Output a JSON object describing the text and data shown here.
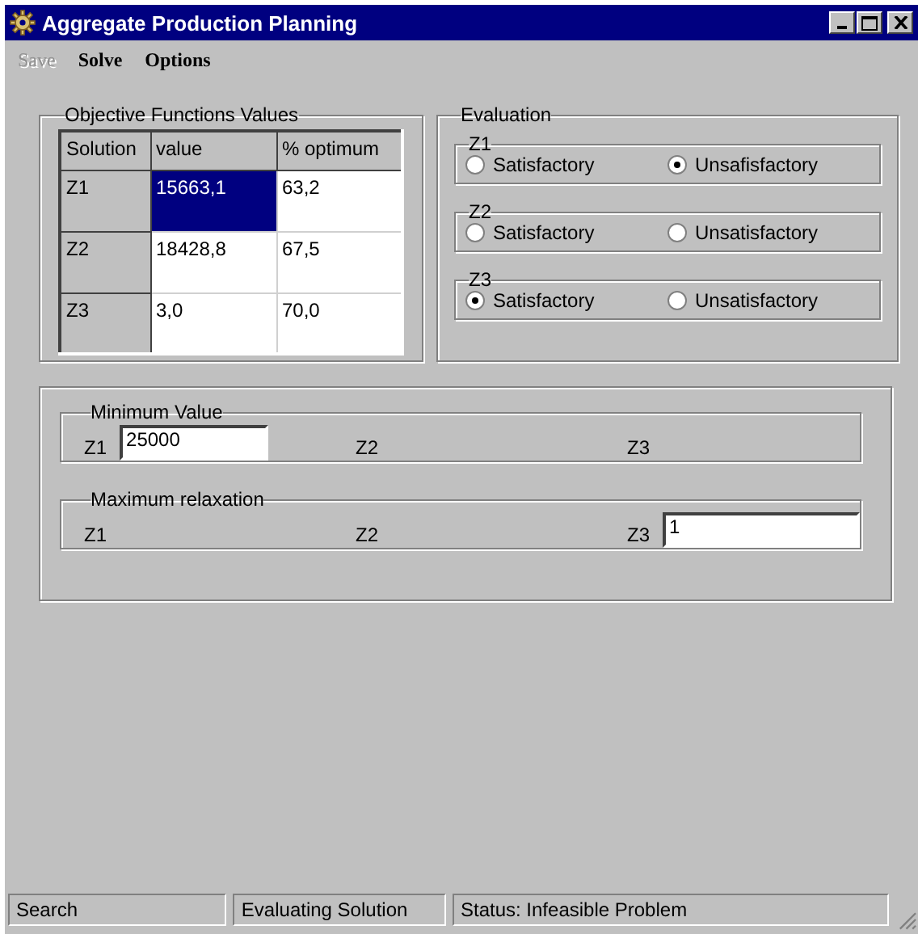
{
  "window": {
    "title": "Aggregate Production Planning"
  },
  "menu": [
    {
      "label": "Save",
      "disabled": true
    },
    {
      "label": "Solve",
      "disabled": false
    },
    {
      "label": "Options",
      "disabled": false
    }
  ],
  "objective_values": {
    "title": "Objective Functions Values",
    "columns": [
      "Solution",
      "value",
      "% optimum"
    ],
    "rows": [
      {
        "cells": [
          {
            "text": "Z1",
            "selected": false
          },
          {
            "text": "15663,1",
            "selected": true
          },
          {
            "text": "63,2",
            "selected": false
          }
        ]
      },
      {
        "cells": [
          {
            "text": "Z2",
            "selected": false
          },
          {
            "text": "18428,8",
            "selected": false
          },
          {
            "text": "67,5",
            "selected": false
          }
        ]
      },
      {
        "cells": [
          {
            "text": "Z3",
            "selected": false
          },
          {
            "text": "3,0",
            "selected": false
          },
          {
            "text": "70,0",
            "selected": false
          }
        ]
      }
    ]
  },
  "evaluation": {
    "title": "Evaluation",
    "groups": [
      {
        "label": "Z1",
        "options": [
          {
            "label": "Satisfactory",
            "selected": false
          },
          {
            "label": "Unsafisfactory",
            "selected": true
          }
        ]
      },
      {
        "label": "Z2",
        "options": [
          {
            "label": "Satisfactory",
            "selected": false
          },
          {
            "label": "Unsatisfactory",
            "selected": false
          }
        ]
      },
      {
        "label": "Z3",
        "options": [
          {
            "label": "Satisfactory",
            "selected": true
          },
          {
            "label": "Unsatisfactory",
            "selected": false
          }
        ]
      }
    ]
  },
  "limits": [
    {
      "title": "Minimum Value",
      "fields": [
        {
          "label": "Z1",
          "value": "25000"
        },
        {
          "label": "Z2"
        },
        {
          "label": "Z3"
        }
      ]
    },
    {
      "title": "Maximum relaxation",
      "fields": [
        {
          "label": "Z1"
        },
        {
          "label": "Z2"
        },
        {
          "label": "Z3",
          "value": "1"
        }
      ]
    }
  ],
  "status_bar": [
    "Search",
    "Evaluating Solution",
    "Status: Infeasible Problem"
  ]
}
